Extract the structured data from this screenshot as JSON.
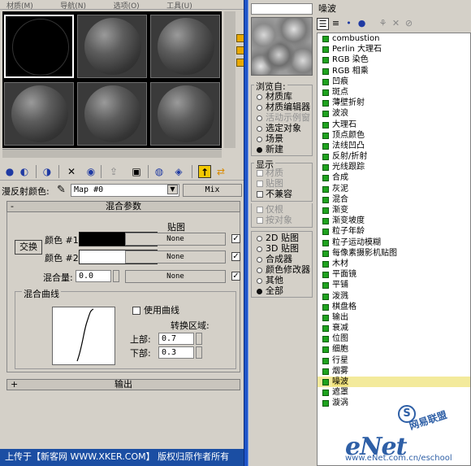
{
  "menubar": {
    "items": [
      "材质(M)",
      "导航(N)",
      "选项(O)",
      "工具(U)"
    ]
  },
  "material_editor": {
    "reflection_color_label": "漫反射颜色:",
    "map_name": "Map #0",
    "map_type": "Mix",
    "rollout_params_title": "混合参数",
    "rollout_params_sign": "-",
    "map_column_label": "贴图",
    "swap_label": "交换",
    "color1_label": "颜色 #1",
    "color2_label": "颜色 #2",
    "color1_hex": "#000000",
    "color2_hex": "#ffffff",
    "none_label": "None",
    "mix_amount_label": "混合量:",
    "mix_amount_value": "0.0",
    "mix_curve_label": "混合曲线",
    "use_curve_label": "使用曲线",
    "transition_label": "转换区域:",
    "upper_label": "上部:",
    "upper_value": "0.7",
    "lower_label": "下部:",
    "lower_value": "0.3",
    "output_title": "输出",
    "output_sign": "+",
    "checkmark": "✓"
  },
  "status_bar": {
    "text": "上传于【新客网 WWW.XKER.COM】 版权归原作者所有"
  },
  "map_browser": {
    "list_title": "噪波",
    "browse_from_label": "浏览自:",
    "browse_from": [
      {
        "label": "材质库",
        "selected": false,
        "disabled": false
      },
      {
        "label": "材质编辑器",
        "selected": false,
        "disabled": false
      },
      {
        "label": "活动示例窗",
        "selected": false,
        "disabled": true
      },
      {
        "label": "选定对象",
        "selected": false,
        "disabled": false
      },
      {
        "label": "场景",
        "selected": false,
        "disabled": false
      },
      {
        "label": "新建",
        "selected": true,
        "disabled": false
      }
    ],
    "show_label": "显示",
    "show_a": [
      {
        "label": "材质",
        "disabled": true
      },
      {
        "label": "贴图",
        "disabled": true
      },
      {
        "label": "不兼容",
        "disabled": false
      }
    ],
    "show_b": [
      {
        "label": "仅根",
        "disabled": true
      },
      {
        "label": "按对象",
        "disabled": true
      }
    ],
    "filter": [
      {
        "label": "2D 贴图",
        "selected": false
      },
      {
        "label": "3D 贴图",
        "selected": false
      },
      {
        "label": "合成器",
        "selected": false
      },
      {
        "label": "颜色修改器",
        "selected": false
      },
      {
        "label": "其他",
        "selected": false
      },
      {
        "label": "全部",
        "selected": true
      }
    ],
    "maps": [
      "combustion",
      "Perlin 大理石",
      "RGB 染色",
      "RGB 相乘",
      "凹痕",
      "斑点",
      "薄壁折射",
      "波浪",
      "大理石",
      "顶点颜色",
      "法线凹凸",
      "反射/折射",
      "光线跟踪",
      "合成",
      "灰泥",
      "混合",
      "渐变",
      "渐变坡度",
      "粒子年龄",
      "粒子运动模糊",
      "每像素摄影机贴图",
      "木材",
      "平面镜",
      "平铺",
      "泼溅",
      "棋盘格",
      "输出",
      "衰减",
      "位图",
      "细胞",
      "行星",
      "烟雾",
      "噪波",
      "遮罩",
      "漩涡"
    ],
    "selected_map": "噪波"
  },
  "watermark": {
    "brand": "eNet",
    "url": "www.eNet.com.cn/eschool",
    "tagline": "网易联盟"
  }
}
